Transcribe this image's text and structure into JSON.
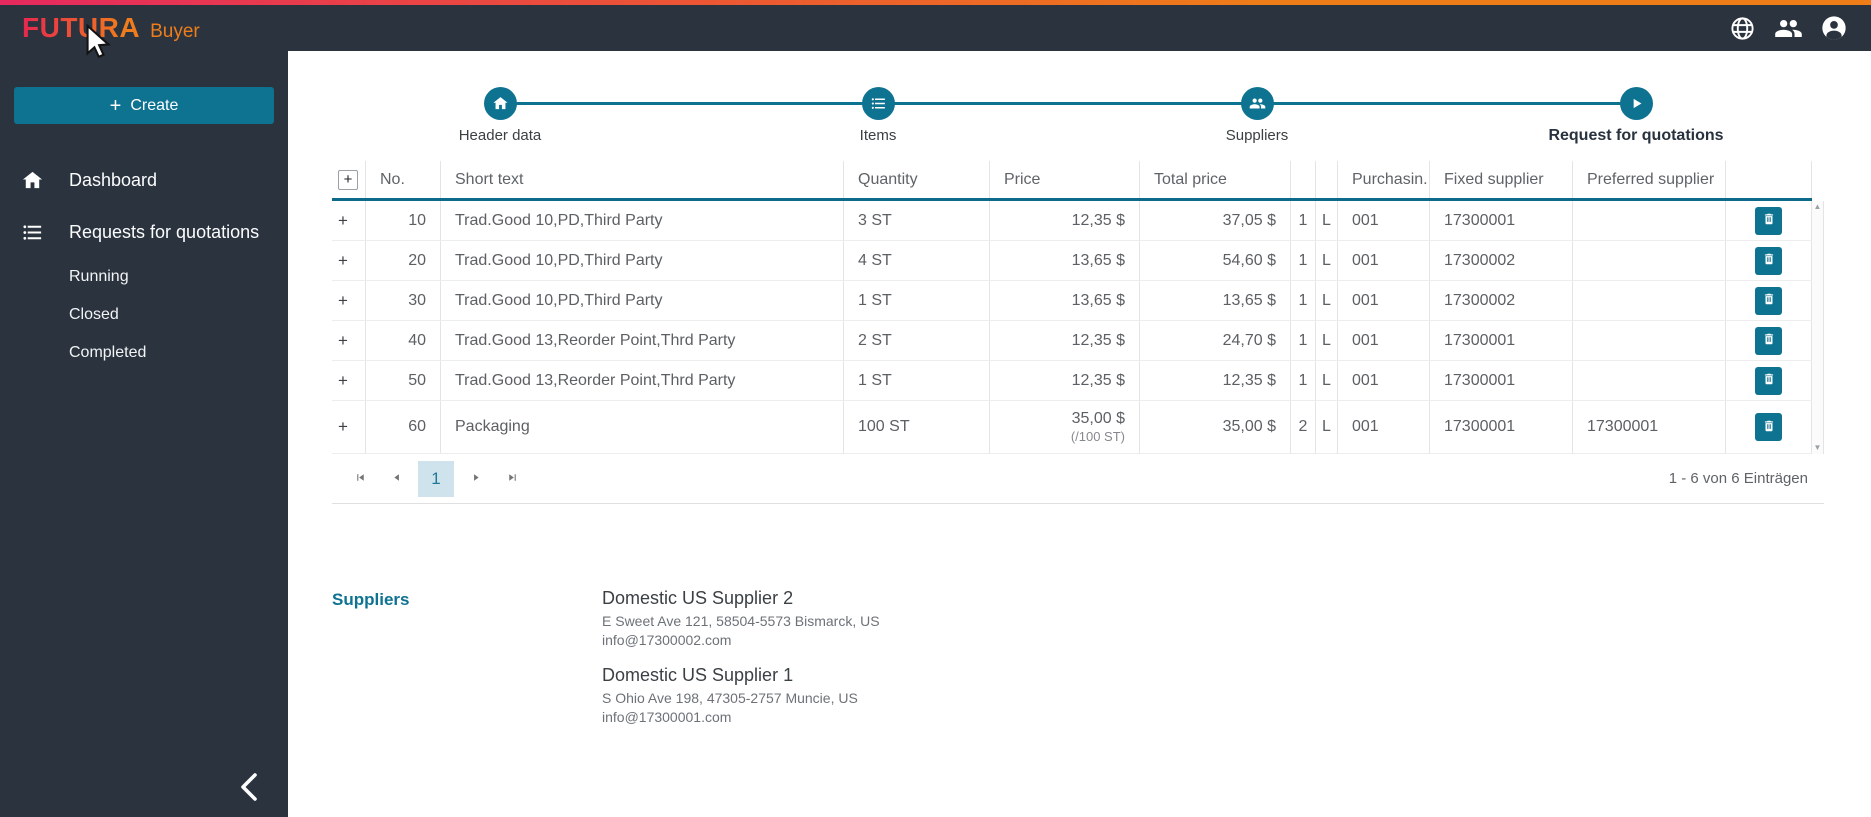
{
  "topbar": {
    "brand": "FUTURA",
    "product": "Buyer"
  },
  "sidebar": {
    "create_label": "Create",
    "items": [
      {
        "label": "Dashboard"
      },
      {
        "label": "Requests for quotations"
      }
    ],
    "sub_items": [
      {
        "label": "Running"
      },
      {
        "label": "Closed"
      },
      {
        "label": "Completed"
      }
    ]
  },
  "stepper": {
    "steps": [
      {
        "label": "Header data"
      },
      {
        "label": "Items"
      },
      {
        "label": "Suppliers"
      },
      {
        "label": "Request for quotations"
      }
    ]
  },
  "table": {
    "headers": {
      "expand": "+",
      "no": "No.",
      "short_text": "Short text",
      "quantity": "Quantity",
      "price": "Price",
      "total_price": "Total price",
      "col1": "",
      "col2": "",
      "purchasing": "Purchasin...",
      "fixed_supplier": "Fixed supplier",
      "preferred_supplier": "Preferred supplier"
    },
    "rows": [
      {
        "expand": "+",
        "no": "10",
        "short_text": "Trad.Good 10,PD,Third Party",
        "quantity": "3 ST",
        "price": "12,35 $",
        "price_unit": "",
        "total_price": "37,05 $",
        "col1": "1",
        "col2": "L",
        "purchasing": "001",
        "fixed_supplier": "17300001",
        "preferred_supplier": ""
      },
      {
        "expand": "+",
        "no": "20",
        "short_text": "Trad.Good 10,PD,Third Party",
        "quantity": "4 ST",
        "price": "13,65 $",
        "price_unit": "",
        "total_price": "54,60 $",
        "col1": "1",
        "col2": "L",
        "purchasing": "001",
        "fixed_supplier": "17300002",
        "preferred_supplier": ""
      },
      {
        "expand": "+",
        "no": "30",
        "short_text": "Trad.Good 10,PD,Third Party",
        "quantity": "1 ST",
        "price": "13,65 $",
        "price_unit": "",
        "total_price": "13,65 $",
        "col1": "1",
        "col2": "L",
        "purchasing": "001",
        "fixed_supplier": "17300002",
        "preferred_supplier": ""
      },
      {
        "expand": "+",
        "no": "40",
        "short_text": "Trad.Good 13,Reorder Point,Thrd Party",
        "quantity": "2 ST",
        "price": "12,35 $",
        "price_unit": "",
        "total_price": "24,70 $",
        "col1": "1",
        "col2": "L",
        "purchasing": "001",
        "fixed_supplier": "17300001",
        "preferred_supplier": ""
      },
      {
        "expand": "+",
        "no": "50",
        "short_text": "Trad.Good 13,Reorder Point,Thrd Party",
        "quantity": "1 ST",
        "price": "12,35 $",
        "price_unit": "",
        "total_price": "12,35 $",
        "col1": "1",
        "col2": "L",
        "purchasing": "001",
        "fixed_supplier": "17300001",
        "preferred_supplier": ""
      },
      {
        "expand": "+",
        "no": "60",
        "short_text": "Packaging",
        "quantity": "100 ST",
        "price": "35,00 $",
        "price_unit": "(/100 ST)",
        "total_price": "35,00 $",
        "col1": "2",
        "col2": "L",
        "purchasing": "001",
        "fixed_supplier": "17300001",
        "preferred_supplier": "17300001"
      }
    ]
  },
  "pagination": {
    "page": "1",
    "info": "1 - 6 von 6 Einträgen"
  },
  "suppliers_section": {
    "title": "Suppliers",
    "suppliers": [
      {
        "name": "Domestic US Supplier 2",
        "address": "E Sweet Ave 121, 58504-5573 Bismarck, US",
        "email": "info@17300002.com"
      },
      {
        "name": "Domestic US Supplier 1",
        "address": "S Ohio Ave 198, 47305-2757 Muncie, US",
        "email": "info@17300001.com"
      }
    ]
  },
  "colors": {
    "accent_teal": "#0e7291",
    "topbar_bg": "#2a333e",
    "gradient_start": "#e6295f",
    "gradient_end": "#ee7d18"
  }
}
